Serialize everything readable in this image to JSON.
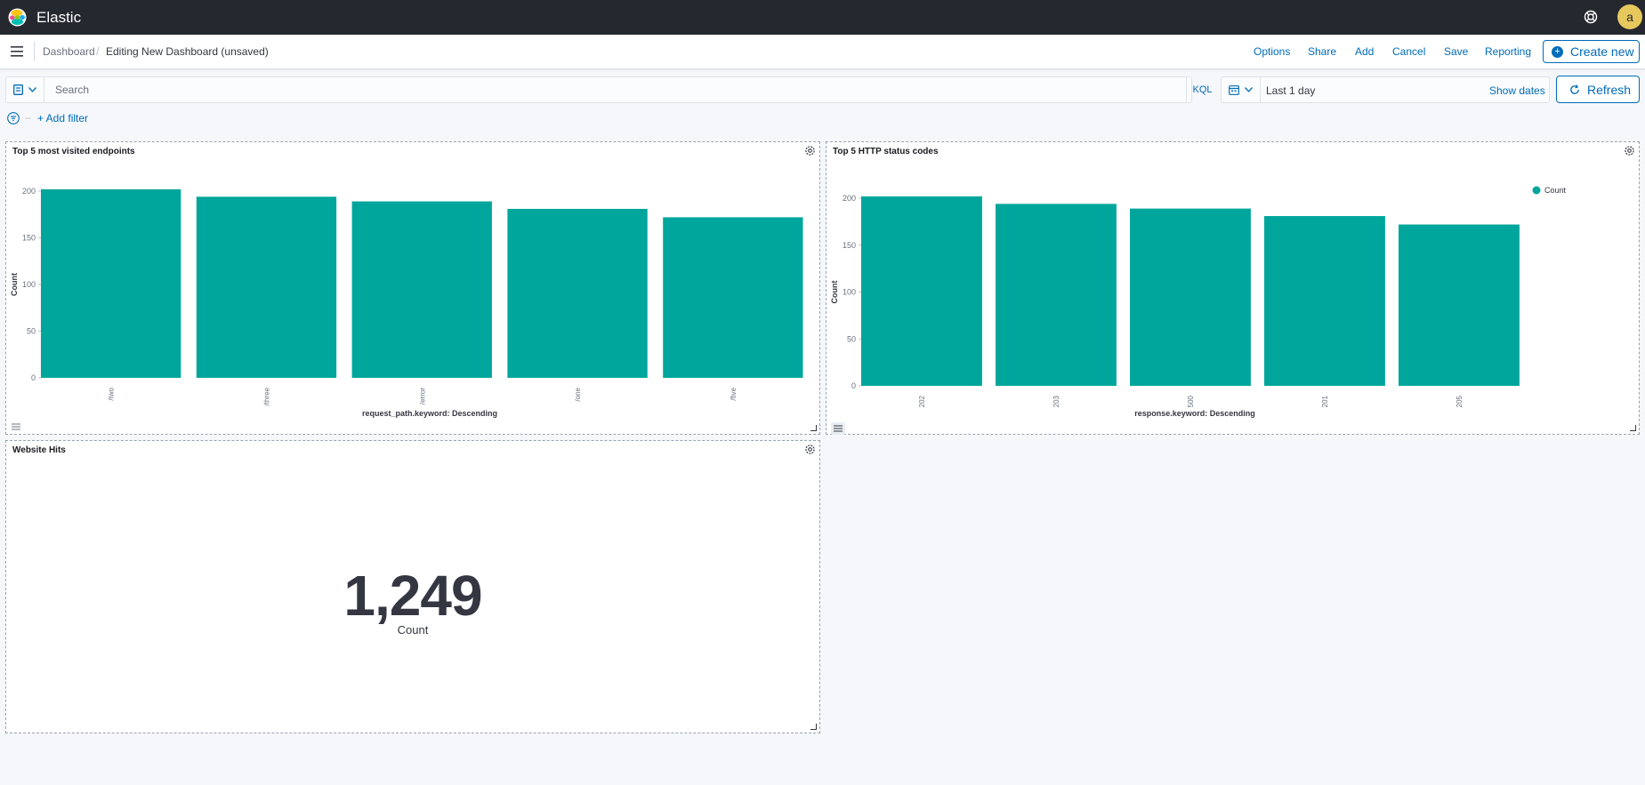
{
  "header": {
    "app_title": "Elastic",
    "avatar_initial": "a"
  },
  "nav": {
    "breadcrumbs": [
      "Dashboard",
      "Editing New Dashboard (unsaved)"
    ],
    "separator": "/",
    "links": [
      "Options",
      "Share",
      "Add",
      "Cancel",
      "Save",
      "Reporting"
    ],
    "create_new": "Create new"
  },
  "query": {
    "placeholder": "Search",
    "language": "KQL",
    "date_range": "Last 1 day",
    "show_dates": "Show dates",
    "refresh": "Refresh"
  },
  "filter": {
    "add_filter": "+ Add filter"
  },
  "colors": {
    "bar": "#00a69b",
    "accent": "#006bb8"
  },
  "panels": {
    "endpoints": {
      "title": "Top 5 most visited endpoints",
      "chart_data": {
        "type": "bar",
        "title": "Top 5 most visited endpoints",
        "categories": [
          "/two",
          "/three",
          "/error",
          "/one",
          "/five"
        ],
        "values": [
          202,
          194,
          189,
          181,
          172
        ],
        "xlabel": "request_path.keyword: Descending",
        "ylabel": "Count",
        "ylim": [
          0,
          200
        ],
        "yticks": [
          0,
          50,
          100,
          150,
          200
        ],
        "legend": false
      }
    },
    "status": {
      "title": "Top 5 HTTP status codes",
      "chart_data": {
        "type": "bar",
        "title": "Top 5 HTTP status codes",
        "categories": [
          "202",
          "203",
          "500",
          "201",
          "205"
        ],
        "series": [
          {
            "name": "Count",
            "values": [
              202,
              194,
              189,
              181,
              172
            ]
          }
        ],
        "xlabel": "response.keyword: Descending",
        "ylabel": "Count",
        "ylim": [
          0,
          200
        ],
        "yticks": [
          0,
          50,
          100,
          150,
          200
        ],
        "legend": "top-right"
      }
    },
    "hits": {
      "title": "Website Hits",
      "value": "1,249",
      "label": "Count"
    }
  }
}
